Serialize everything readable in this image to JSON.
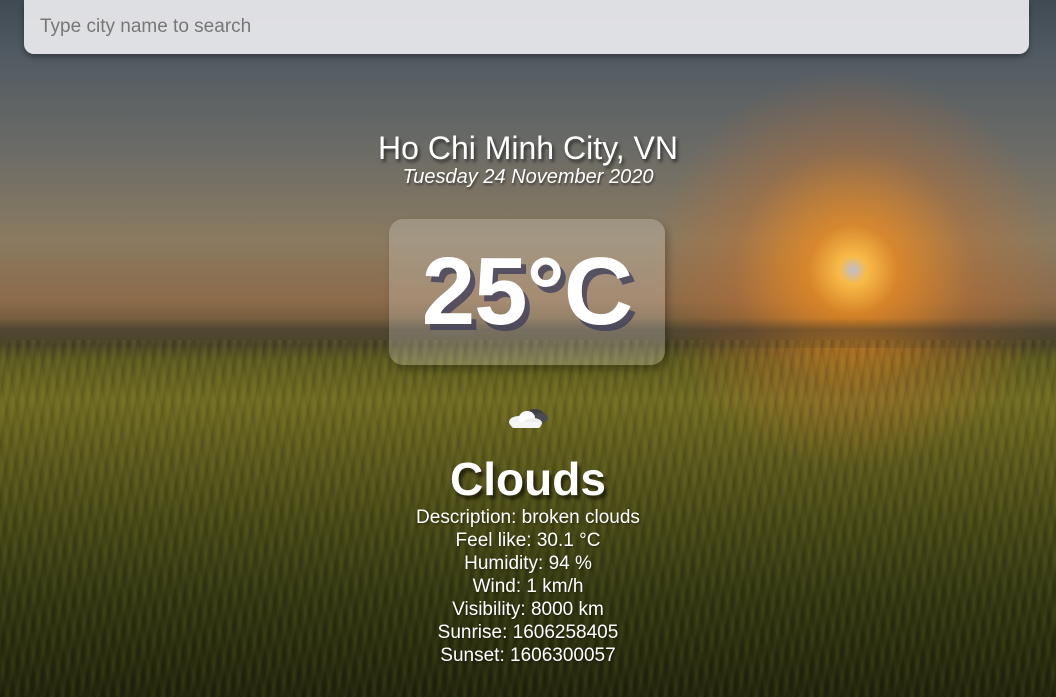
{
  "search": {
    "placeholder": "Type city name to search",
    "value": ""
  },
  "location": {
    "city": "Ho Chi Minh City, VN",
    "date": "Tuesday 24 November 2020"
  },
  "temperature": {
    "display": "25°C"
  },
  "weather": {
    "icon": "cloud-icon",
    "main": "Clouds",
    "details": [
      "Description: broken clouds",
      "Feel like: 30.1 °C",
      "Humidity: 94 %",
      "Wind: 1 km/h",
      "Visibility: 8000 km",
      "Sunrise: 1606258405",
      "Sunset: 1606300057"
    ]
  }
}
